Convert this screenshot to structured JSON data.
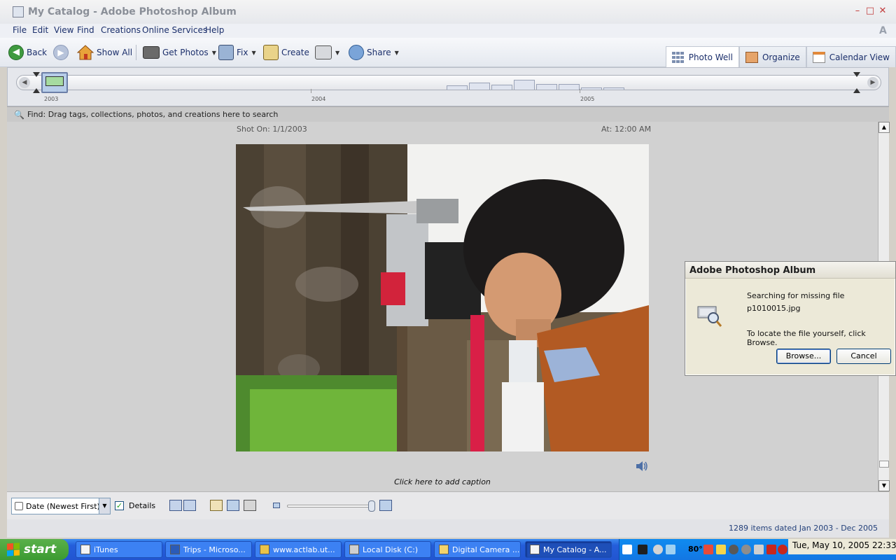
{
  "window": {
    "title": "My Catalog - Adobe Photoshop Album",
    "minimize": "–",
    "maximize": "□",
    "close": "✕"
  },
  "menu": [
    {
      "label": "File"
    },
    {
      "label": "Edit"
    },
    {
      "label": "View"
    },
    {
      "label": "Find"
    },
    {
      "label": "Creations"
    },
    {
      "label": "Online Services"
    },
    {
      "label": "Help"
    }
  ],
  "toolbar": {
    "back": "Back",
    "show_all": "Show All",
    "get_photos": "Get Photos",
    "fix": "Fix",
    "create": "Create",
    "share": "Share"
  },
  "view_tabs": {
    "photo_well": "Photo Well",
    "organize": "Organize",
    "calendar_view": "Calendar View"
  },
  "timeline": {
    "years": [
      "2003",
      "2004",
      "2005"
    ]
  },
  "find_bar": {
    "text": "Find: Drag tags, collections, photos, and creations here to search"
  },
  "photo": {
    "shot_on": "Shot On: 1/1/2003",
    "at": "At: 12:00 AM",
    "caption": "Click here to add caption"
  },
  "dialog": {
    "title": "Adobe Photoshop Album",
    "line1": "Searching for missing file",
    "filename": "p1010015.jpg",
    "line2": "To locate the file yourself, click Browse.",
    "browse": "Browse...",
    "cancel": "Cancel"
  },
  "bottom": {
    "sort": "Date (Newest First)",
    "details": "Details",
    "details_checked": true
  },
  "status": {
    "text": "1289 items dated Jan 2003 - Dec 2005"
  },
  "taskbar": {
    "start": "start",
    "tasks": [
      {
        "label": "iTunes"
      },
      {
        "label": "Trips - Microso..."
      },
      {
        "label": "www.actlab.ut..."
      },
      {
        "label": "Local Disk (C:)"
      },
      {
        "label": "Digital Camera ..."
      },
      {
        "label": "My Catalog - A..."
      }
    ],
    "temperature": "80°",
    "clock": "Tue, May 10, 2005  22:33"
  },
  "colors": {
    "menu_text": "#1b2f6b",
    "taskbar": "#245edb",
    "start_green": "#3b9a31"
  }
}
